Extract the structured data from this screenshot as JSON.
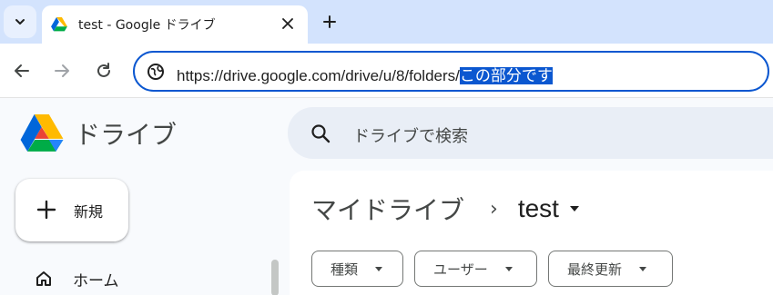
{
  "browser": {
    "tab_title": "test - Google ドライブ",
    "url_prefix": "https://drive.google.com/drive/u/8/folders/",
    "url_selected": "この部分です"
  },
  "drive": {
    "logo_text": "ドライブ",
    "search_placeholder": "ドライブで検索",
    "new_button_label": "新規",
    "nav": {
      "home_label": "ホーム"
    },
    "breadcrumb": {
      "root": "マイドライブ",
      "separator": "›",
      "current": "test"
    },
    "filters": [
      {
        "label": "種類"
      },
      {
        "label": "ユーザー"
      },
      {
        "label": "最終更新"
      }
    ]
  },
  "colors": {
    "accent": "#0b57d0",
    "tabstrip": "#d3e3fd",
    "search_bg": "#e9eef6",
    "text_secondary": "#444746"
  },
  "icons": [
    "tab-search-icon",
    "drive-favicon-icon",
    "close-icon",
    "plus-icon",
    "back-arrow-icon",
    "forward-arrow-icon",
    "reload-icon",
    "site-info-icon",
    "drive-logo-icon",
    "search-icon",
    "home-icon",
    "chevron-right-icon",
    "caret-down-icon"
  ]
}
